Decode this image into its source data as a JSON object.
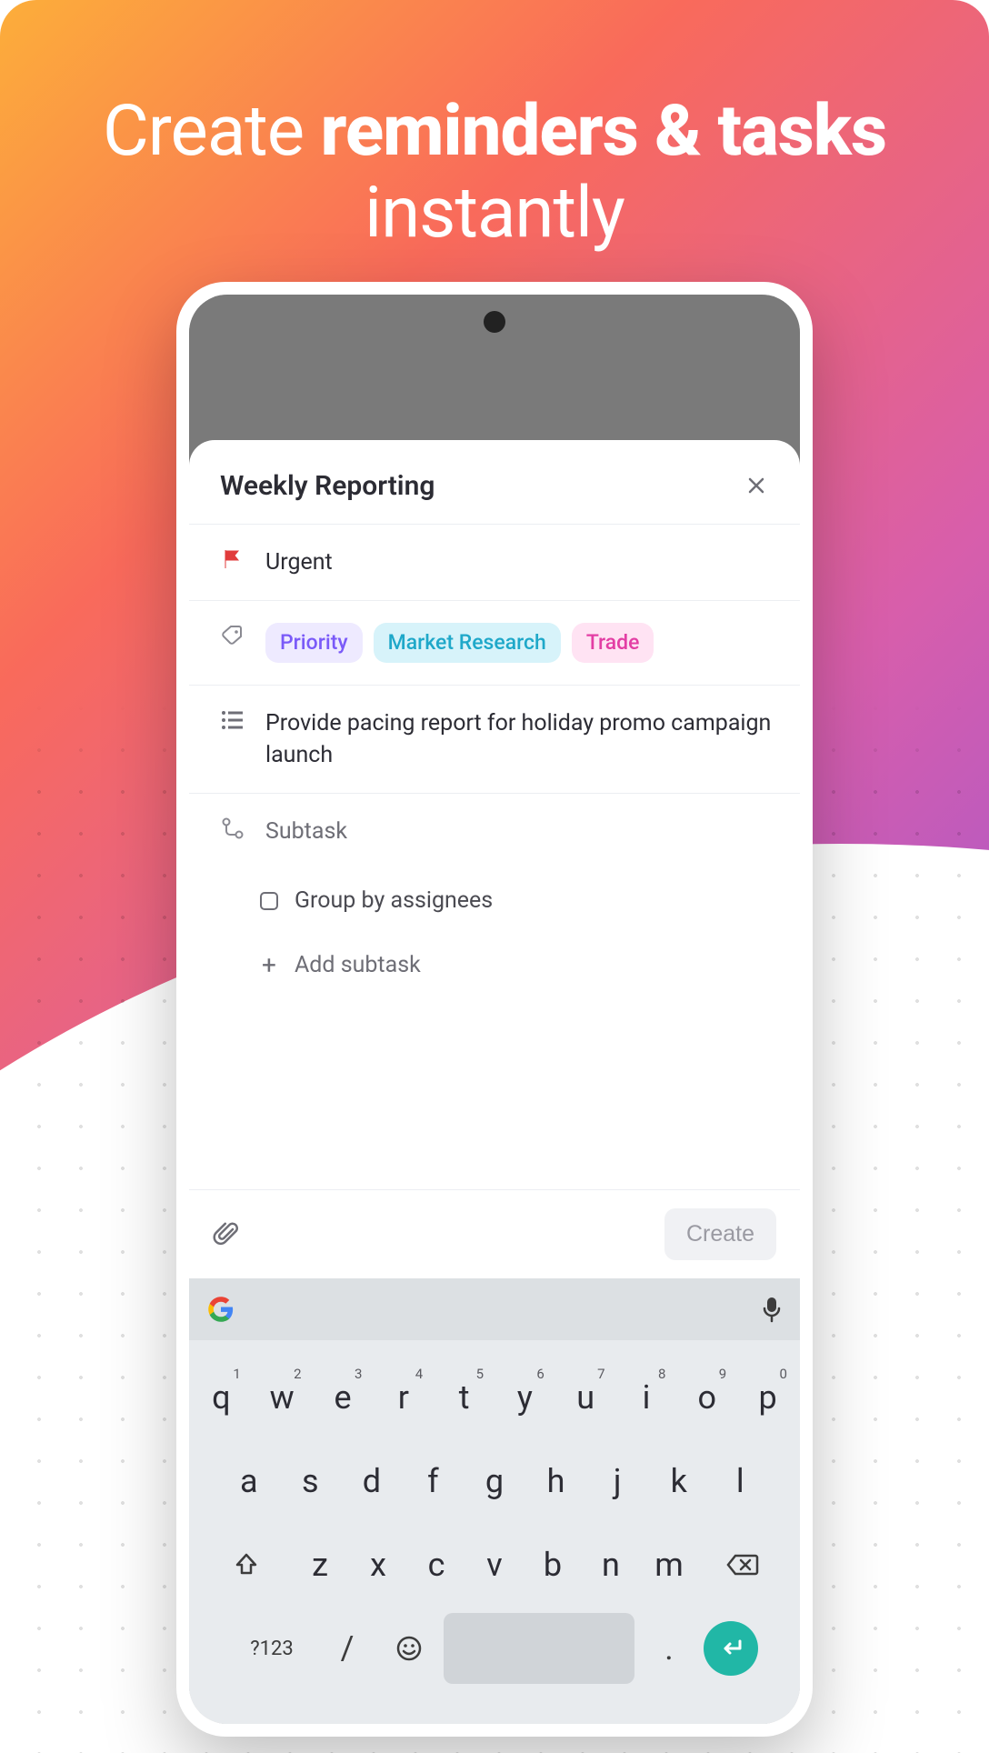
{
  "headline": {
    "pre": "Create ",
    "bold": "reminders & tasks",
    "post": " instantly"
  },
  "sheet": {
    "title": "Weekly Reporting",
    "priority_row": {
      "label": "Urgent"
    },
    "tags": [
      {
        "label": "Priority",
        "bg": "#eeeaff",
        "fg": "#7a5af8"
      },
      {
        "label": "Market Research",
        "bg": "#d7f3fa",
        "fg": "#1fa8c9"
      },
      {
        "label": "Trade",
        "bg": "#ffe3f3",
        "fg": "#e33ea4"
      }
    ],
    "description": "Provide pacing report for holiday promo campaign launch",
    "subtask_header": "Subtask",
    "subtasks": [
      {
        "label": "Group by assignees"
      }
    ],
    "add_subtask": "Add subtask",
    "create_label": "Create"
  },
  "keyboard": {
    "row1": [
      {
        "k": "q",
        "s": "1"
      },
      {
        "k": "w",
        "s": "2"
      },
      {
        "k": "e",
        "s": "3"
      },
      {
        "k": "r",
        "s": "4"
      },
      {
        "k": "t",
        "s": "5"
      },
      {
        "k": "y",
        "s": "6"
      },
      {
        "k": "u",
        "s": "7"
      },
      {
        "k": "i",
        "s": "8"
      },
      {
        "k": "o",
        "s": "9"
      },
      {
        "k": "p",
        "s": "0"
      }
    ],
    "row2": [
      "a",
      "s",
      "d",
      "f",
      "g",
      "h",
      "j",
      "k",
      "l"
    ],
    "row3": [
      "z",
      "x",
      "c",
      "v",
      "b",
      "n",
      "m"
    ],
    "sym": "?123",
    "slash": "/",
    "period": "."
  }
}
